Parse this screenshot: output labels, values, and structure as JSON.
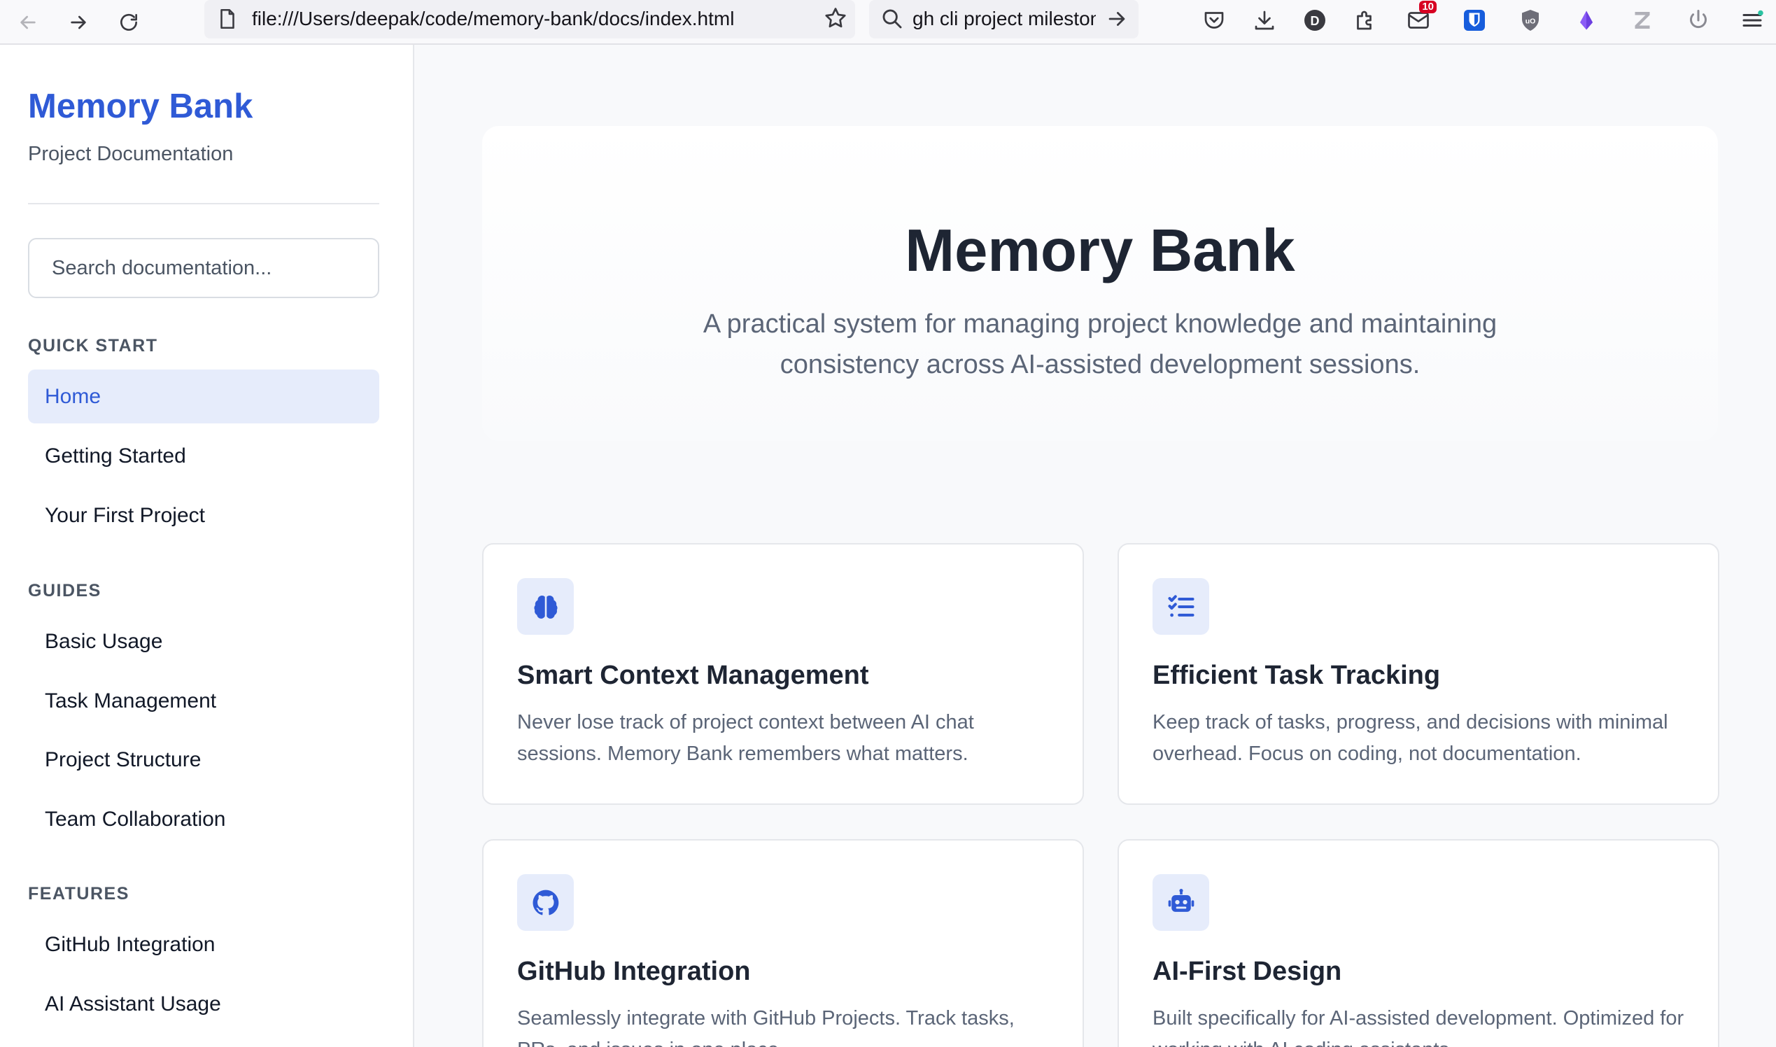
{
  "browser": {
    "url": "file:///Users/deepak/code/memory-bank/docs/index.html",
    "search_query": "gh cli project milestone",
    "notification_count": "10",
    "profile_initial": "D"
  },
  "sidebar": {
    "brand": "Memory Bank",
    "tagline": "Project Documentation",
    "search_placeholder": "Search documentation...",
    "sections": [
      {
        "label": "QUICK START",
        "items": [
          {
            "label": "Home",
            "active": true
          },
          {
            "label": "Getting Started"
          },
          {
            "label": "Your First Project"
          }
        ]
      },
      {
        "label": "GUIDES",
        "items": [
          {
            "label": "Basic Usage"
          },
          {
            "label": "Task Management"
          },
          {
            "label": "Project Structure"
          },
          {
            "label": "Team Collaboration"
          }
        ]
      },
      {
        "label": "FEATURES",
        "items": [
          {
            "label": "GitHub Integration"
          },
          {
            "label": "AI Assistant Usage"
          }
        ]
      }
    ]
  },
  "hero": {
    "title": "Memory Bank",
    "subtitle": "A practical system for managing project knowledge and maintaining consistency across AI-assisted development sessions."
  },
  "features": [
    {
      "icon": "brain-icon",
      "title": "Smart Context Management",
      "description": "Never lose track of project context between AI chat sessions. Memory Bank remembers what matters."
    },
    {
      "icon": "list-check-icon",
      "title": "Efficient Task Tracking",
      "description": "Keep track of tasks, progress, and decisions with minimal overhead. Focus on coding, not documentation."
    },
    {
      "icon": "github-icon",
      "title": "GitHub Integration",
      "description": "Seamlessly integrate with GitHub Projects. Track tasks, PRs, and issues in one place."
    },
    {
      "icon": "robot-icon",
      "title": "AI-First Design",
      "description": "Built specifically for AI-assisted development. Optimized for working with AI coding assistants."
    }
  ],
  "colors": {
    "accent": "#2f5ad6",
    "accent_bg": "#e6ecfb",
    "heading": "#1e2533",
    "muted": "#5b6577"
  }
}
